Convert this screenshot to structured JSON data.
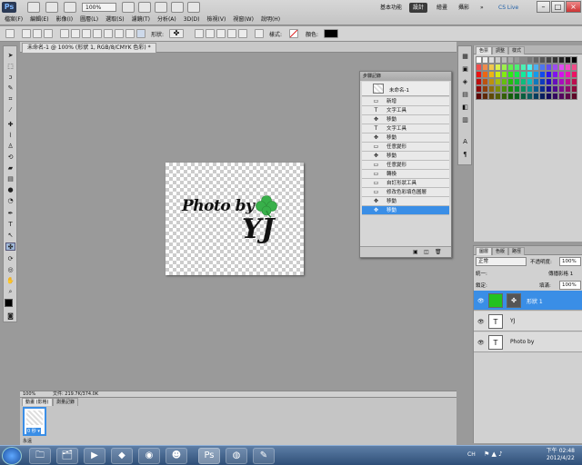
{
  "app": {
    "logo": "Ps",
    "zoom": "100%",
    "workspaces": [
      "基本功能",
      "設計",
      "繪畫",
      "攝影"
    ],
    "active_workspace": "設計",
    "cs_live": "CS Live",
    "more": "»"
  },
  "menu": [
    "檔案(F)",
    "編輯(E)",
    "影像(I)",
    "圖層(L)",
    "選取(S)",
    "濾鏡(T)",
    "分析(A)",
    "3D(D)",
    "檢視(V)",
    "視窗(W)",
    "說明(H)"
  ],
  "options": {
    "shape_label": "形狀:",
    "style_label": "樣式:",
    "color_label": "顏色:"
  },
  "document": {
    "tab_title": "未命名-1 @ 100% (形狀 1, RGB/8/CMYK 色彩) *",
    "zoom": "100%",
    "file_info": "文件: 219.7K/374.0K",
    "artwork_text_1": "Photo by",
    "artwork_text_2": "YJ"
  },
  "history": {
    "title": "步驟記錄",
    "snapshot": "未命名-1",
    "items": [
      {
        "label": "新增",
        "icon": "doc"
      },
      {
        "label": "文字工具",
        "icon": "T"
      },
      {
        "label": "移動",
        "icon": "move"
      },
      {
        "label": "文字工具",
        "icon": "T"
      },
      {
        "label": "移動",
        "icon": "move"
      },
      {
        "label": "任意變形",
        "icon": "doc"
      },
      {
        "label": "移動",
        "icon": "move"
      },
      {
        "label": "任意變形",
        "icon": "doc"
      },
      {
        "label": "轉換",
        "icon": "doc"
      },
      {
        "label": "自訂形狀工具",
        "icon": "doc"
      },
      {
        "label": "修改色彩填色圖層",
        "icon": "doc"
      },
      {
        "label": "移動",
        "icon": "move"
      },
      {
        "label": "移動",
        "icon": "move",
        "selected": true
      }
    ]
  },
  "swatches_panel": {
    "tabs": [
      "色票",
      "調整",
      "樣式"
    ],
    "active_tab": "色票"
  },
  "layers_panel": {
    "tabs": [
      "圖層",
      "色版",
      "路徑"
    ],
    "blend_mode": "正常",
    "opacity_label": "不透明度:",
    "opacity": "100%",
    "unify_label": "統一:",
    "propagate_label": "傳播影格 1",
    "lock_label": "鎖定:",
    "fill_label": "填滿:",
    "fill": "100%",
    "layers": [
      {
        "name": "形狀 1",
        "type": "shape",
        "selected": true
      },
      {
        "name": "YJ",
        "type": "text"
      },
      {
        "name": "Photo by",
        "type": "text"
      }
    ]
  },
  "animation_panel": {
    "tabs": [
      "動畫 (影格)",
      "測量記錄"
    ],
    "frame_delay": "0 秒 ▾",
    "loop": "永遠"
  },
  "taskbar": {
    "time": "下午 02:48",
    "date": "2012/4/22",
    "lang": "CH"
  },
  "colors": {
    "accent": "#3a8ee6",
    "clover": "#38b04a"
  }
}
